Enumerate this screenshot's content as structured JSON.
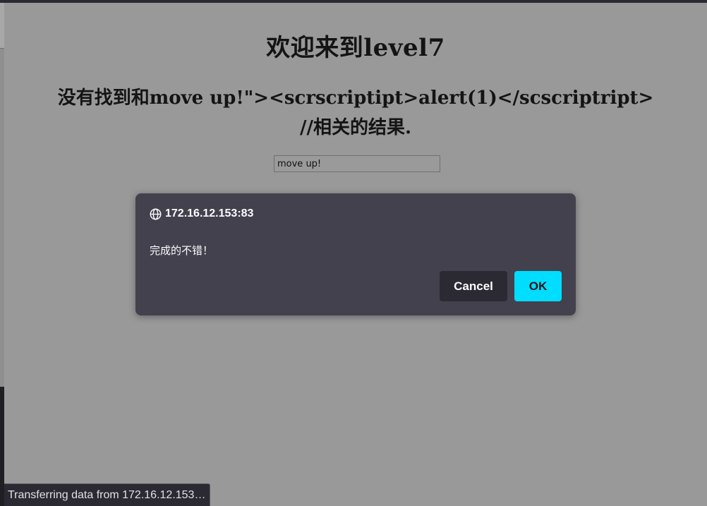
{
  "page": {
    "title": "欢迎来到level7",
    "result_line1": "没有找到和move up!\"><scrscriptipt>alert(1)</scscriptript>",
    "result_line2": "//相关的结果."
  },
  "search": {
    "value": "move up!"
  },
  "dialog": {
    "origin": "172.16.12.153:83",
    "message": "完成的不错！",
    "cancel_label": "Cancel",
    "ok_label": "OK",
    "origin_icon": "globe-icon"
  },
  "status_bar": {
    "text": "Transferring data from 172.16.12.153…"
  },
  "colors": {
    "page_overlay": "#999999",
    "dialog_bg": "#42414d",
    "ok_button": "#00ddff",
    "cancel_button": "#2b2a33"
  }
}
